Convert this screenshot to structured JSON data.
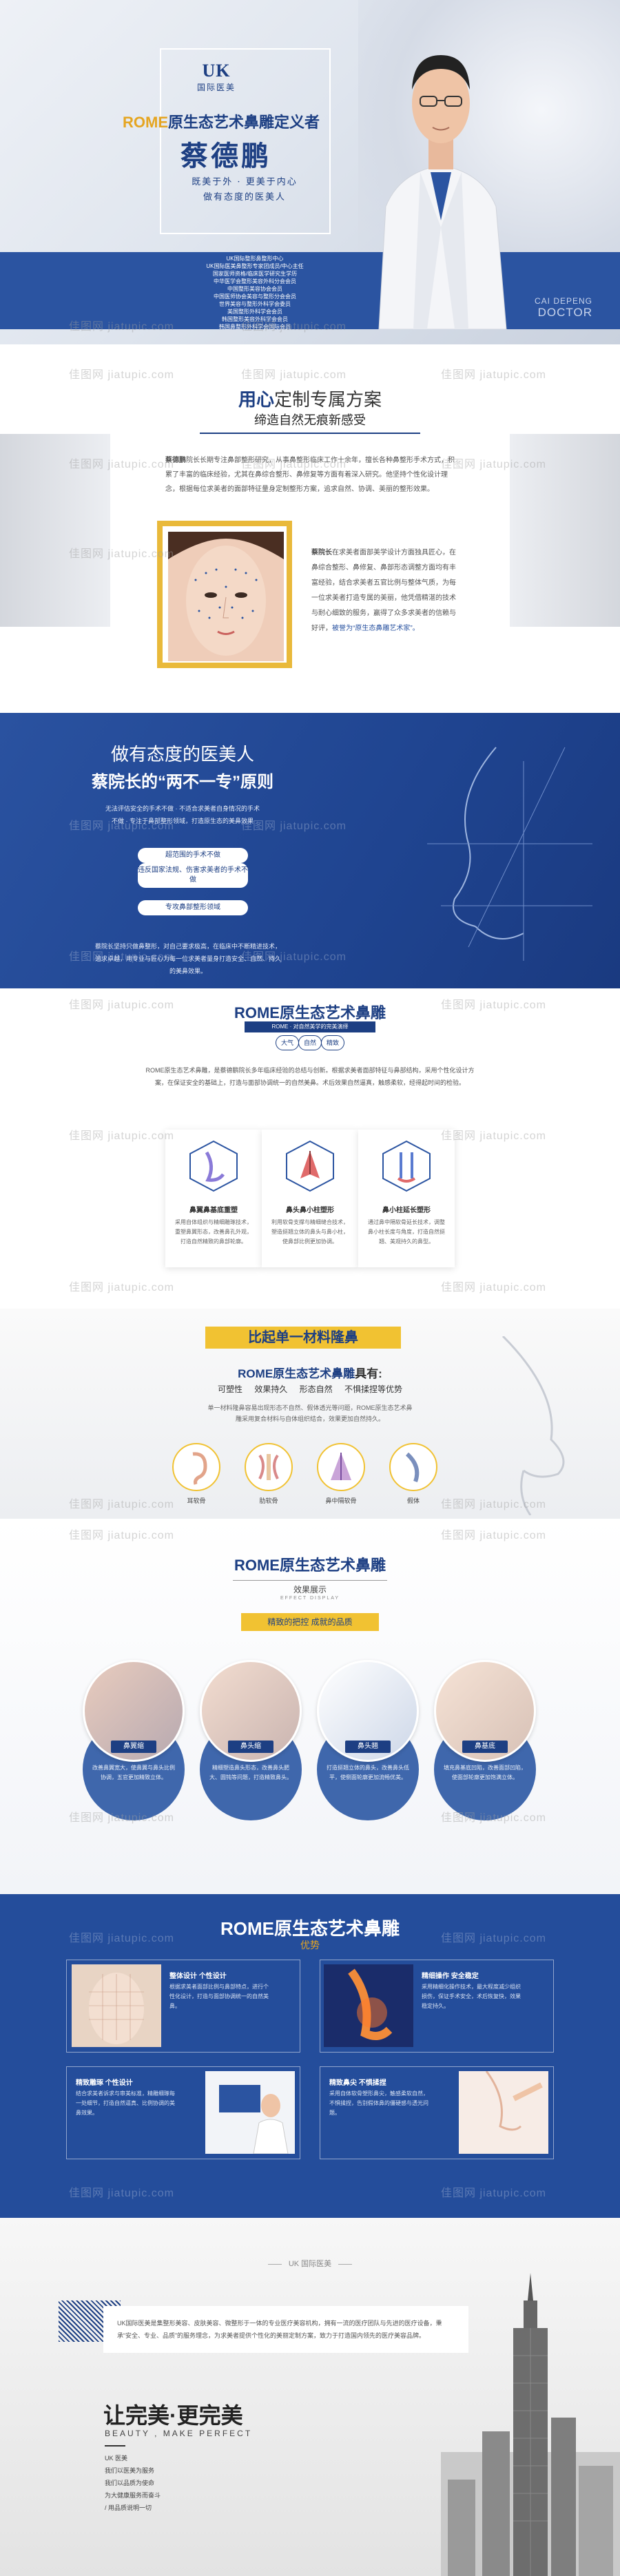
{
  "hero": {
    "logo": "UK",
    "logo_sub": "国际医美",
    "title_accent": "ROME",
    "title_rest": "原生态艺术鼻雕定义者",
    "name": "蔡德鹏",
    "slogan": [
      "既美于外 · 更美于内心",
      "做有态度的医美人"
    ],
    "credentials": [
      "UK国际整形鼻整形中心",
      "UK国际医美鼻整形专家团成员/中心主任",
      "国家医师资格/临床医学研究生学历",
      "中华医学会整形美容外科分会会员",
      "中国整形美容协会会员",
      "中国医师协会美容与整形分会会员",
      "世界美容与整形外科学会委员",
      "美国整形外科学会会员",
      "韩国整形美容外科学会会员",
      "韩国鼻整形外科学会国际会员"
    ],
    "en_name": "CAI DEPENG",
    "en_title": "DOCTOR"
  },
  "watermark": "佳图网 jiatupic.com",
  "plan": {
    "title_accent": "用心",
    "title_rest": "定制专属方案",
    "subtitle": "缔造自然无痕新感受",
    "para1_lead": "蔡德鹏",
    "para1": "院长长期专注鼻部整形研究，从事鼻整形临床工作十余年，擅长各种鼻整形手术方式，积累了丰富的临床经验，尤其在鼻综合整形、鼻修复等方面有着深入研究。他坚持个性化设计理念，根据每位求美者的面部特征量身定制整形方案，追求自然、协调、美丽的整形效果。",
    "para2_lead": "蔡院长",
    "para2": "在求美者面部美学设计方面独具匠心，在鼻综合整形、鼻修复、鼻部形态调整方面均有丰富经验，结合求美者五官比例与整体气质，为每一位求美者打造专属的美丽，他凭借精湛的技术与耐心细致的服务，赢得了众多求美者的信赖与好评，",
    "para2_hl": "被誉为“原生态鼻雕艺术家”。"
  },
  "attitude": {
    "line1": "做有态度的医美人",
    "line2": "蔡院长的“两不一专”原则",
    "text": "无法评估安全的手术不做 · 不适合求美者自身情况的手术不做 · 专注于鼻部整形领域，打造原生态的美鼻效果",
    "pill1": "超范围的手术不做",
    "pill2": "违反国家法规、伤害求美者的手术不做",
    "pill3": "专攻鼻部整形领域",
    "foot": "蔡院长坚持只做鼻整形，对自己要求极高，在临床中不断精进技术，追求卓越，用专业与匠心为每一位求美者量身打造安全、自然、持久的美鼻效果。"
  },
  "rome": {
    "title": "ROME原生态艺术鼻雕",
    "tag": "ROME · 对自然美学的完美演绎",
    "tri": [
      "大气",
      "自然",
      "精致"
    ],
    "intro": "ROME原生态艺术鼻雕，是蔡德鹏院长多年临床经验的总结与创新。根据求美者面部特征与鼻部结构，采用个性化设计方案，在保证安全的基础上，打造与面部协调统一的自然美鼻。术后效果自然逼真，触感柔软，经得起时间的检验。",
    "cards": [
      {
        "title": "鼻翼鼻基底重塑",
        "desc": "采用自体组织与精细雕琢技术，重塑鼻翼形态，改善鼻孔外观，打造自然精致的鼻部轮廓。"
      },
      {
        "title": "鼻头鼻小柱塑形",
        "desc": "利用软骨支撑与精细缝合技术，塑造挺翘立体的鼻头与鼻小柱，使鼻部比例更加协调。"
      },
      {
        "title": "鼻小柱延长塑形",
        "desc": "通过鼻中隔软骨延长技术，调整鼻小柱长度与角度，打造自然挺翘、美观持久的鼻型。"
      }
    ]
  },
  "material": {
    "banner": "比起单一材料隆鼻",
    "title_blue": "ROME原生态艺术鼻雕",
    "title_rest": "具有:",
    "features": [
      "可塑性",
      "效果持久",
      "形态自然",
      "不惧揉捏等优势"
    ],
    "text": "单一材料隆鼻容易出现形态不自然、假体透光等问题，ROME原生态艺术鼻雕采用复合材料与自体组织结合，效果更加自然持久。",
    "items": [
      "耳软骨",
      "肋软骨",
      "鼻中隔软骨",
      "假体"
    ]
  },
  "effects": {
    "title": "ROME原生态艺术鼻雕",
    "sub": "效果展示",
    "sub_en": "EFFECT DISPLAY",
    "banner": "精致的把控 成就的品质",
    "items": [
      {
        "label": "鼻翼缩",
        "desc": "改善鼻翼宽大，使鼻翼与鼻头比例协调，五官更加精致立体。"
      },
      {
        "label": "鼻头缩",
        "desc": "精细塑造鼻头形态，改善鼻头肥大、圆钝等问题，打造精致鼻头。"
      },
      {
        "label": "鼻头翘",
        "desc": "打造挺翘立体的鼻头，改善鼻头低平，使侧面轮廓更加流畅优美。"
      },
      {
        "label": "鼻基底",
        "desc": "填充鼻基底凹陷，改善面部凹陷，使面部轮廓更加饱满立体。"
      }
    ]
  },
  "advantages": {
    "title_a": "ROME原生态",
    "title_b": "艺术鼻雕",
    "subtitle": "优势",
    "items": [
      {
        "title": "整体设计 个性设计",
        "desc": "根据求美者面部比例与鼻部特点，进行个性化设计，打造与面部协调统一的自然美鼻。"
      },
      {
        "title": "精细操作 安全稳定",
        "desc": "采用精细化操作技术，最大程度减少组织损伤，保证手术安全，术后恢复快，效果稳定持久。"
      },
      {
        "title": "精致雕琢 个性设计",
        "desc": "结合求美者诉求与审美标准，精雕细琢每一处细节，打造自然逼真、比例协调的美鼻效果。"
      },
      {
        "title": "精致鼻尖 不惧揉捏",
        "desc": "采用自体软骨塑形鼻尖，触感柔软自然，不惧揉捏，告别假体鼻的僵硬感与透光问题。"
      }
    ]
  },
  "about": {
    "header": "UK 国际医美",
    "para": "UK国际医美是集整形美容、皮肤美容、微整形于一体的专业医疗美容机构，拥有一流的医疗团队与先进的医疗设备，秉承“安全、专业、品质”的服务理念，为求美者提供个性化的美丽定制方案，致力于打造国内领先的医疗美容品牌。",
    "big": "让完美·更完美",
    "en": "BEAUTY , MAKE PERFECT",
    "list": [
      "UK 医美",
      "我们以医美为服务",
      "我们以品质为使命",
      "为大健康服务而奋斗",
      "/ 用品质说明一切"
    ]
  }
}
